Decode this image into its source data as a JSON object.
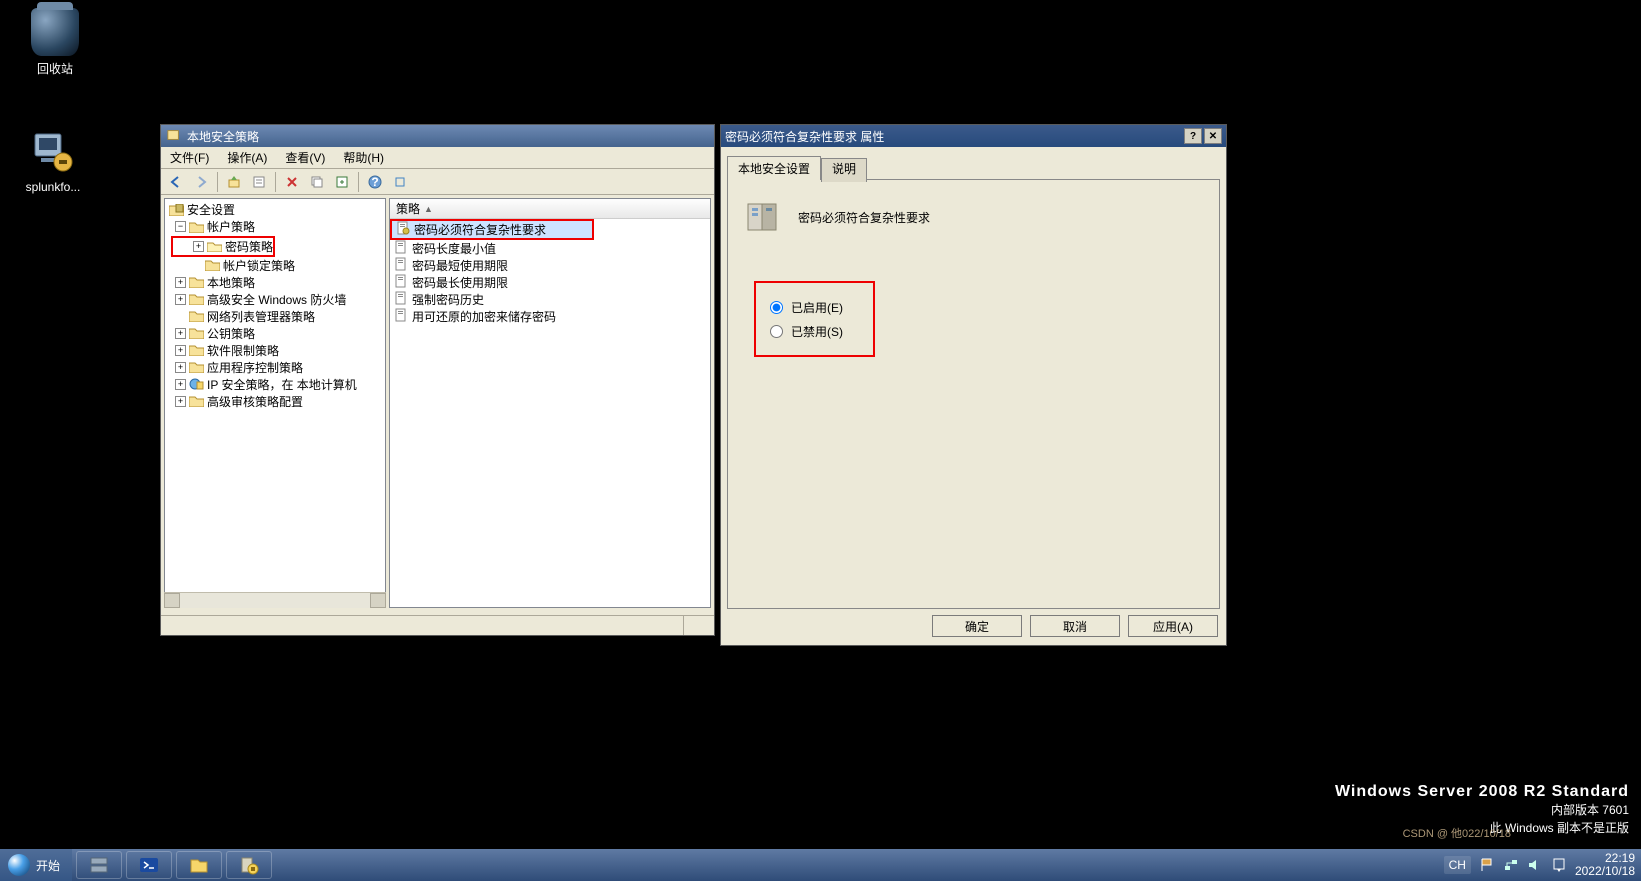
{
  "desktop": {
    "recycle_bin": "回收站",
    "splunk": "splunkfo..."
  },
  "secpol": {
    "title": "本地安全策略",
    "menu": {
      "file": "文件(F)",
      "action": "操作(A)",
      "view": "查看(V)",
      "help": "帮助(H)"
    },
    "tree": {
      "root": "安全设置",
      "account": "帐户策略",
      "password": "密码策略",
      "lockout": "帐户锁定策略",
      "localpol": "本地策略",
      "wfas": "高级安全 Windows 防火墙",
      "nlm": "网络列表管理器策略",
      "pubkey": "公钥策略",
      "srp": "软件限制策略",
      "appctrl": "应用程序控制策略",
      "ipsec": "IP 安全策略，在 本地计算机",
      "advaudit": "高级审核策略配置"
    },
    "list": {
      "header": "策略",
      "items": [
        "密码必须符合复杂性要求",
        "密码长度最小值",
        "密码最短使用期限",
        "密码最长使用期限",
        "强制密码历史",
        "用可还原的加密来储存密码"
      ]
    }
  },
  "dlg": {
    "title": "密码必须符合复杂性要求 属性",
    "tab_local": "本地安全设置",
    "tab_explain": "说明",
    "heading": "密码必须符合复杂性要求",
    "opt_enable": "已启用(E)",
    "opt_disable": "已禁用(S)",
    "btn_ok": "确定",
    "btn_cancel": "取消",
    "btn_apply": "应用(A)"
  },
  "os": {
    "name": "Windows Server 2008 R2 Standard",
    "build": "内部版本 7601",
    "genuine": "此 Windows 副本不是正版"
  },
  "taskbar": {
    "start": "开始",
    "lang": "CH",
    "time": "22:19",
    "date": "2022/10/18"
  },
  "csdn": "CSDN @ 他022/10/18"
}
